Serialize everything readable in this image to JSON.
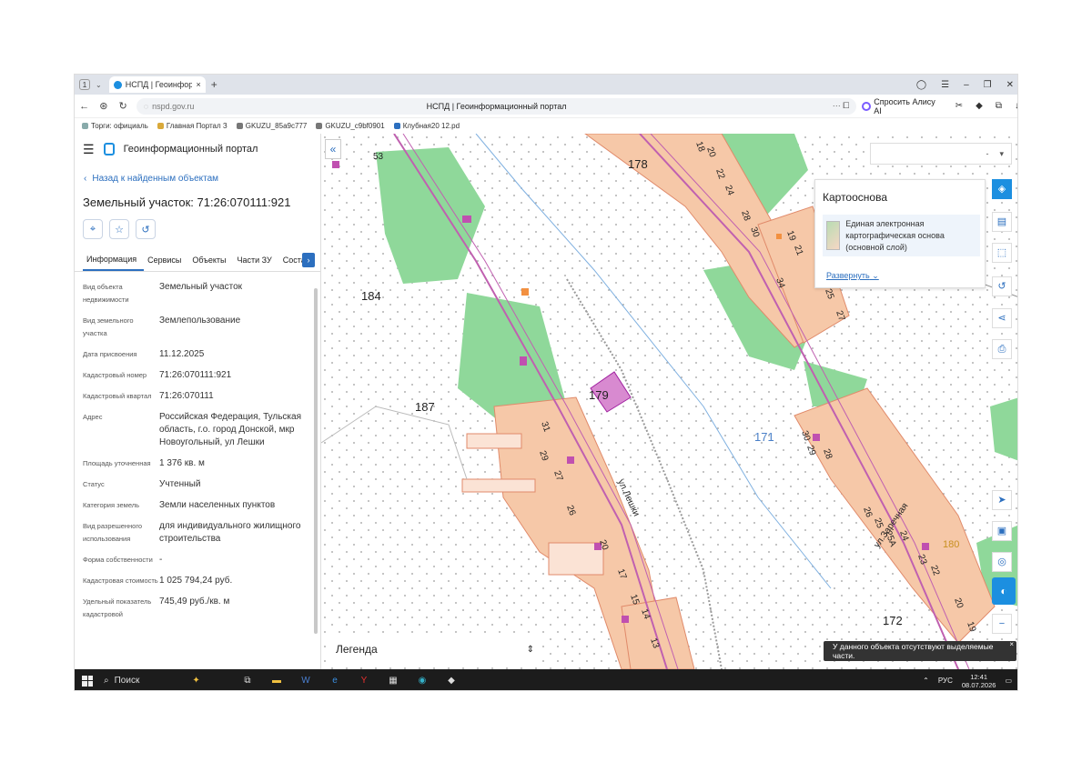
{
  "browser": {
    "tab_count": "1",
    "tab_title": "НСПД | Геоинформаци",
    "url_host": "nspd.gov.ru",
    "page_title": "НСПД | Геоинформационный портал",
    "alice_label": "Спросить Алису AI",
    "bookmarks": [
      "Торги: официаль",
      "Главная Портал З",
      "GKUZU_85a9c777",
      "GKUZU_c9bf0901",
      "Клубная20 12.pd"
    ]
  },
  "sidebar": {
    "portal_title": "Геоинформационный портал",
    "back_link": "Назад к найденным объектам",
    "object_title": "Земельный участок: 71:26:070111:921",
    "tabs": [
      "Информация",
      "Сервисы",
      "Объекты",
      "Части ЗУ",
      "Состав"
    ],
    "properties": [
      {
        "key": "Вид объекта недвижимости",
        "value": "Земельный участок"
      },
      {
        "key": "Вид земельного участка",
        "value": "Землепользование"
      },
      {
        "key": "Дата присвоения",
        "value": "11.12.2025"
      },
      {
        "key": "Кадастровый номер",
        "value": "71:26:070111:921"
      },
      {
        "key": "Кадастровый квартал",
        "value": "71:26:070111"
      },
      {
        "key": "Адрес",
        "value": "Российская Федерация, Тульская область, г.о. город Донской, мкр Новоугольный, ул Лешки"
      },
      {
        "key": "Площадь уточненная",
        "value": "1 376 кв. м"
      },
      {
        "key": "Статус",
        "value": "Учтенный"
      },
      {
        "key": "Категория земель",
        "value": "Земли населенных пунктов"
      },
      {
        "key": "Вид разрешенного использования",
        "value": "для индивидуального жилищного строительства"
      },
      {
        "key": "Форма собственности",
        "value": "-"
      },
      {
        "key": "Кадастровая стоимость",
        "value": "1 025 794,24 руб."
      },
      {
        "key": "Удельный показатель кадастровой",
        "value": "745,49 руб./кв. м"
      }
    ]
  },
  "map": {
    "layer_select_value": "-",
    "basemap_title": "Картооснова",
    "basemap_layer": "Единая электронная картографическая основа (основной слой)",
    "expand_link": "Развернуть",
    "legend_label": "Легенда",
    "toast_text": "У данного объекта отсутствуют выделяемые части.",
    "labels": {
      "q184": "184",
      "q187": "187",
      "q178": "178",
      "q179": "179",
      "q171": "171",
      "q172": "172",
      "q180": "180",
      "street_leshki": "ул.Лешки",
      "street_zarechnaya": "ул.Заречная",
      "h53": "53",
      "h18": "18",
      "h20": "20",
      "h22": "22",
      "h24": "24",
      "h28": "28",
      "h30": "30",
      "h34": "34",
      "h19": "19",
      "h21": "21",
      "h25": "25",
      "h27": "27",
      "h31": "31",
      "h29": "29",
      "h27b": "27",
      "h26": "26",
      "h20b": "20",
      "h17": "17",
      "h15": "15",
      "h14": "14",
      "h13": "13",
      "h30b": "30",
      "h29b": "29",
      "h28b": "28",
      "h26b": "26",
      "h25b": "25",
      "h25a": "25А",
      "h24b": "24",
      "h23": "23",
      "h22b": "22",
      "h20c": "20",
      "h19b": "19"
    }
  },
  "taskbar": {
    "search_label": "Поиск",
    "lang": "РУС",
    "time": "12:41",
    "date": "08.07.2026"
  },
  "colors": {
    "accent": "#1c8fe0",
    "parcel_orange": "#f6c8a8",
    "green_zone": "#8fd89a",
    "selected_parcel": "#d88ad0"
  }
}
